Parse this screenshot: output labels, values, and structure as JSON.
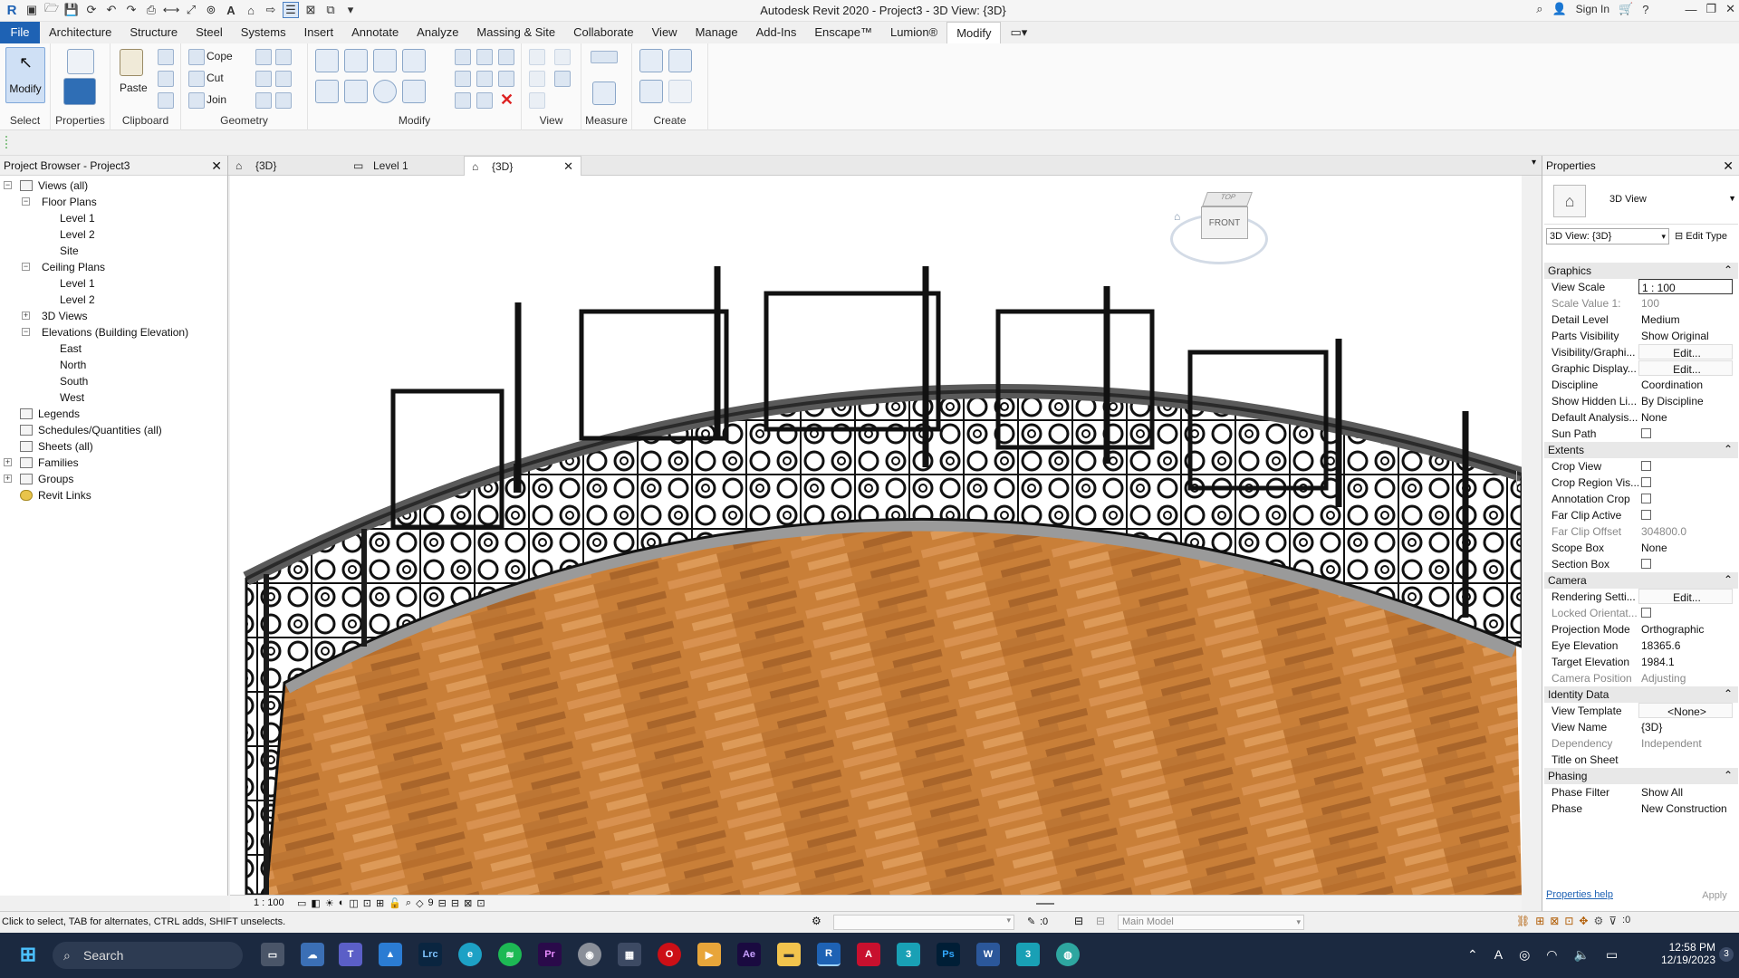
{
  "window": {
    "title": "Autodesk Revit 2020 - Project3 - 3D View: {3D}",
    "sign_in": "Sign In"
  },
  "ribbon_tabs": [
    "File",
    "Architecture",
    "Structure",
    "Steel",
    "Systems",
    "Insert",
    "Annotate",
    "Analyze",
    "Massing & Site",
    "Collaborate",
    "View",
    "Manage",
    "Add-Ins",
    "Enscape™",
    "Lumion®",
    "Modify"
  ],
  "ribbon": {
    "select_label": "Select",
    "modify_button": "Modify",
    "properties_label": "Properties",
    "paste_button": "Paste",
    "clipboard_label": "Clipboard",
    "cope": "Cope",
    "cut": "Cut",
    "join": "Join",
    "geometry_label": "Geometry",
    "modify_label": "Modify",
    "view_label": "View",
    "measure_label": "Measure",
    "create_label": "Create"
  },
  "project_browser": {
    "title": "Project Browser - Project3",
    "views_all": "Views (all)",
    "floor_plans": "Floor Plans",
    "floor_items": [
      "Level 1",
      "Level 2",
      "Site"
    ],
    "ceiling_plans": "Ceiling Plans",
    "ceiling_items": [
      "Level 1",
      "Level 2"
    ],
    "views_3d": "3D Views",
    "elevations": "Elevations (Building Elevation)",
    "elevation_items": [
      "East",
      "North",
      "South",
      "West"
    ],
    "legends": "Legends",
    "schedules": "Schedules/Quantities (all)",
    "sheets": "Sheets (all)",
    "families": "Families",
    "groups": "Groups",
    "revit_links": "Revit Links"
  },
  "view_tabs": [
    "{3D}",
    "Level 1",
    "{3D}"
  ],
  "viewcube": {
    "top": "TOP",
    "front": "FRONT"
  },
  "view_control_bar": {
    "scale": "1 : 100",
    "count": "9"
  },
  "properties": {
    "title": "Properties",
    "type_name": "3D View",
    "selector": "3D View: {3D}",
    "edit_type": "Edit Type",
    "groups": {
      "graphics": "Graphics",
      "extents": "Extents",
      "camera": "Camera",
      "identity": "Identity Data",
      "phasing": "Phasing"
    },
    "graphics_rows": [
      {
        "k": "View Scale",
        "v": "1 : 100"
      },
      {
        "k": "Scale Value    1:",
        "v": "100"
      },
      {
        "k": "Detail Level",
        "v": "Medium"
      },
      {
        "k": "Parts Visibility",
        "v": "Show Original"
      },
      {
        "k": "Visibility/Graphi...",
        "v": "Edit..."
      },
      {
        "k": "Graphic Display...",
        "v": "Edit..."
      },
      {
        "k": "Discipline",
        "v": "Coordination"
      },
      {
        "k": "Show Hidden Li...",
        "v": "By Discipline"
      },
      {
        "k": "Default Analysis...",
        "v": "None"
      },
      {
        "k": "Sun Path",
        "v": ""
      }
    ],
    "extents_rows": [
      {
        "k": "Crop View",
        "v": ""
      },
      {
        "k": "Crop Region Vis...",
        "v": ""
      },
      {
        "k": "Annotation Crop",
        "v": ""
      },
      {
        "k": "Far Clip Active",
        "v": ""
      },
      {
        "k": "Far Clip Offset",
        "v": "304800.0"
      },
      {
        "k": "Scope Box",
        "v": "None"
      },
      {
        "k": "Section Box",
        "v": ""
      }
    ],
    "camera_rows": [
      {
        "k": "Rendering Setti...",
        "v": "Edit..."
      },
      {
        "k": "Locked Orientat...",
        "v": ""
      },
      {
        "k": "Projection Mode",
        "v": "Orthographic"
      },
      {
        "k": "Eye Elevation",
        "v": "18365.6"
      },
      {
        "k": "Target Elevation",
        "v": "1984.1"
      },
      {
        "k": "Camera Position",
        "v": "Adjusting"
      }
    ],
    "identity_rows": [
      {
        "k": "View Template",
        "v": "<None>"
      },
      {
        "k": "View Name",
        "v": "{3D}"
      },
      {
        "k": "Dependency",
        "v": "Independent"
      },
      {
        "k": "Title on Sheet",
        "v": ""
      }
    ],
    "phasing_rows": [
      {
        "k": "Phase Filter",
        "v": "Show All"
      },
      {
        "k": "Phase",
        "v": "New Construction"
      }
    ],
    "help_link": "Properties help",
    "apply": "Apply"
  },
  "status": {
    "hint": "Click to select, TAB for alternates, CTRL adds, SHIFT unselects.",
    "filter_count": ":0",
    "model": "Main Model",
    "selection_count": ":0"
  },
  "taskbar": {
    "search": "Search",
    "time": "12:58 PM",
    "date": "12/19/2023",
    "notification_count": "3"
  }
}
